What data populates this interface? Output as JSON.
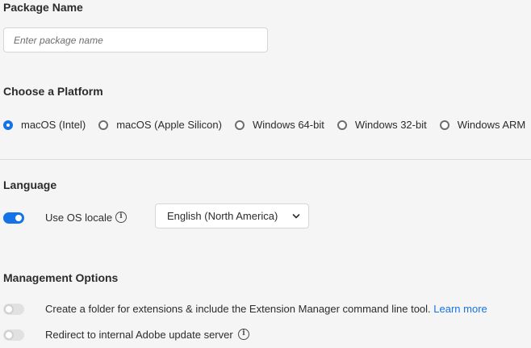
{
  "package_name": {
    "title": "Package Name",
    "input_value": "",
    "input_placeholder": "Enter package name"
  },
  "platform": {
    "title": "Choose a Platform",
    "options": [
      {
        "label": "macOS (Intel)",
        "selected": true
      },
      {
        "label": "macOS (Apple Silicon)",
        "selected": false
      },
      {
        "label": "Windows 64-bit",
        "selected": false
      },
      {
        "label": "Windows 32-bit",
        "selected": false
      },
      {
        "label": "Windows ARM",
        "selected": false
      }
    ]
  },
  "language": {
    "title": "Language",
    "use_os_locale_label": "Use OS locale",
    "use_os_locale_on": true,
    "selected_language": "English (North America)"
  },
  "management": {
    "title": "Management Options",
    "extensions_folder_label": "Create a folder for extensions & include the Extension Manager command line tool.",
    "extensions_folder_link": "Learn more",
    "extensions_folder_on": false,
    "redirect_label": "Redirect to internal Adobe update server",
    "redirect_on": false
  },
  "icons": {
    "info": "info-icon",
    "chevron": "chevron-down-icon"
  },
  "colors": {
    "accent": "#1473e6",
    "text": "#2c2c2c",
    "background": "#f5f5f5"
  }
}
